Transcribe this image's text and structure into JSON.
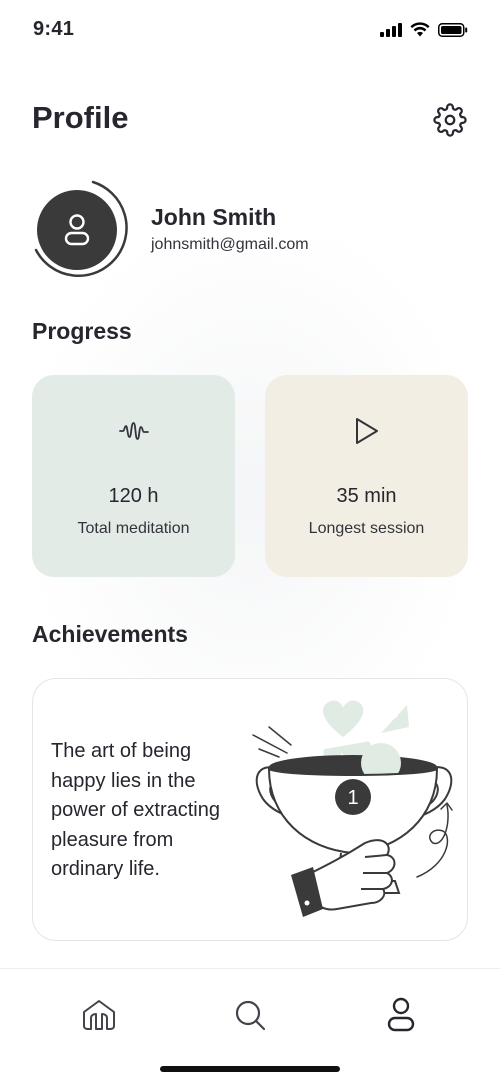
{
  "status_bar": {
    "time": "9:41"
  },
  "header": {
    "title": "Profile"
  },
  "profile": {
    "name": "John Smith",
    "email": "johnsmith@gmail.com"
  },
  "progress": {
    "title": "Progress",
    "cards": [
      {
        "value": "120 h",
        "label": "Total meditation",
        "icon": "waveform-icon",
        "color": "#e2ebe5"
      },
      {
        "value": "35 min",
        "label": "Longest session",
        "icon": "play-icon",
        "color": "#f3eee4"
      }
    ]
  },
  "achievements": {
    "title": "Achievements",
    "quote": "The art of being happy lies in the power of extracting pleasure from ordinary life.",
    "trophy_number": "1"
  },
  "tab_bar": {
    "items": [
      "home-icon",
      "search-icon",
      "profile-icon"
    ]
  }
}
